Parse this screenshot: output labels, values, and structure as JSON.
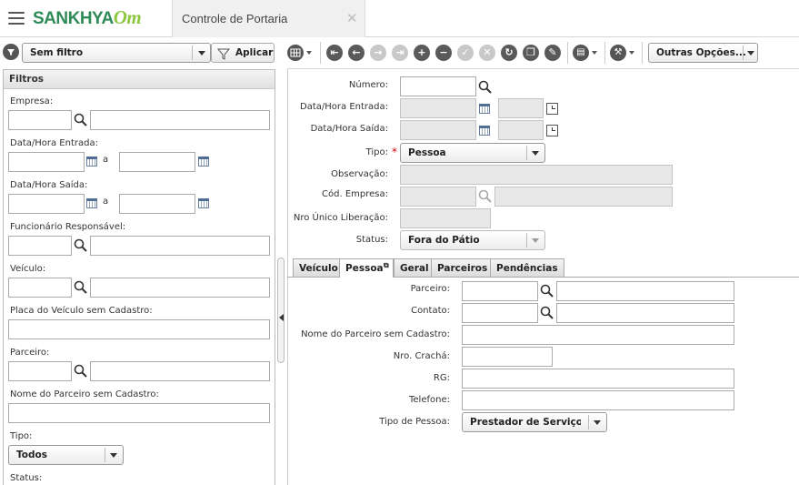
{
  "header": {
    "logo_main": "SANKHYA",
    "logo_suffix": "Om",
    "tab_title": "Controle de Portaria",
    "close_glyph": "✕"
  },
  "filter_bar": {
    "filter_select": "Sem filtro",
    "apply_label": "Aplicar"
  },
  "filters": {
    "title": "Filtros",
    "empresa": "Empresa:",
    "data_entrada": "Data/Hora Entrada:",
    "data_saida": "Data/Hora Saída:",
    "range_sep": "a",
    "funcionario": "Funcionário Responsável:",
    "veiculo": "Veículo:",
    "placa": "Placa do Veículo sem Cadastro:",
    "parceiro": "Parceiro:",
    "nome_parceiro": "Nome do Parceiro sem Cadastro:",
    "tipo": "Tipo:",
    "tipo_value": "Todos",
    "status": "Status:"
  },
  "toolbar": {
    "more_options": "Outras Opções..."
  },
  "form": {
    "numero": "Número:",
    "data_entrada": "Data/Hora Entrada:",
    "data_saida": "Data/Hora Saída:",
    "tipo": "Tipo:",
    "tipo_required": "*",
    "tipo_value": "Pessoa",
    "observacao": "Observação:",
    "cod_empresa": "Cód. Empresa:",
    "nro_unico": "Nro Único Liberação:",
    "status": "Status:",
    "status_value": "Fora do Pátio"
  },
  "tabs": [
    "Veículo",
    "Pessoa",
    "Geral",
    "Parceiros",
    "Pendências"
  ],
  "pessoa": {
    "parceiro": "Parceiro:",
    "contato": "Contato:",
    "nome_parceiro": "Nome do Parceiro sem Cadastro:",
    "cracha": "Nro. Crachá:",
    "rg": "RG:",
    "telefone": "Telefone:",
    "tipo_pessoa": "Tipo de Pessoa:",
    "tipo_pessoa_value": "Prestador de Serviços"
  },
  "colors": {
    "brand_green": "#2e8b57",
    "brand_lime": "#8dc63f",
    "required": "#d00000"
  }
}
